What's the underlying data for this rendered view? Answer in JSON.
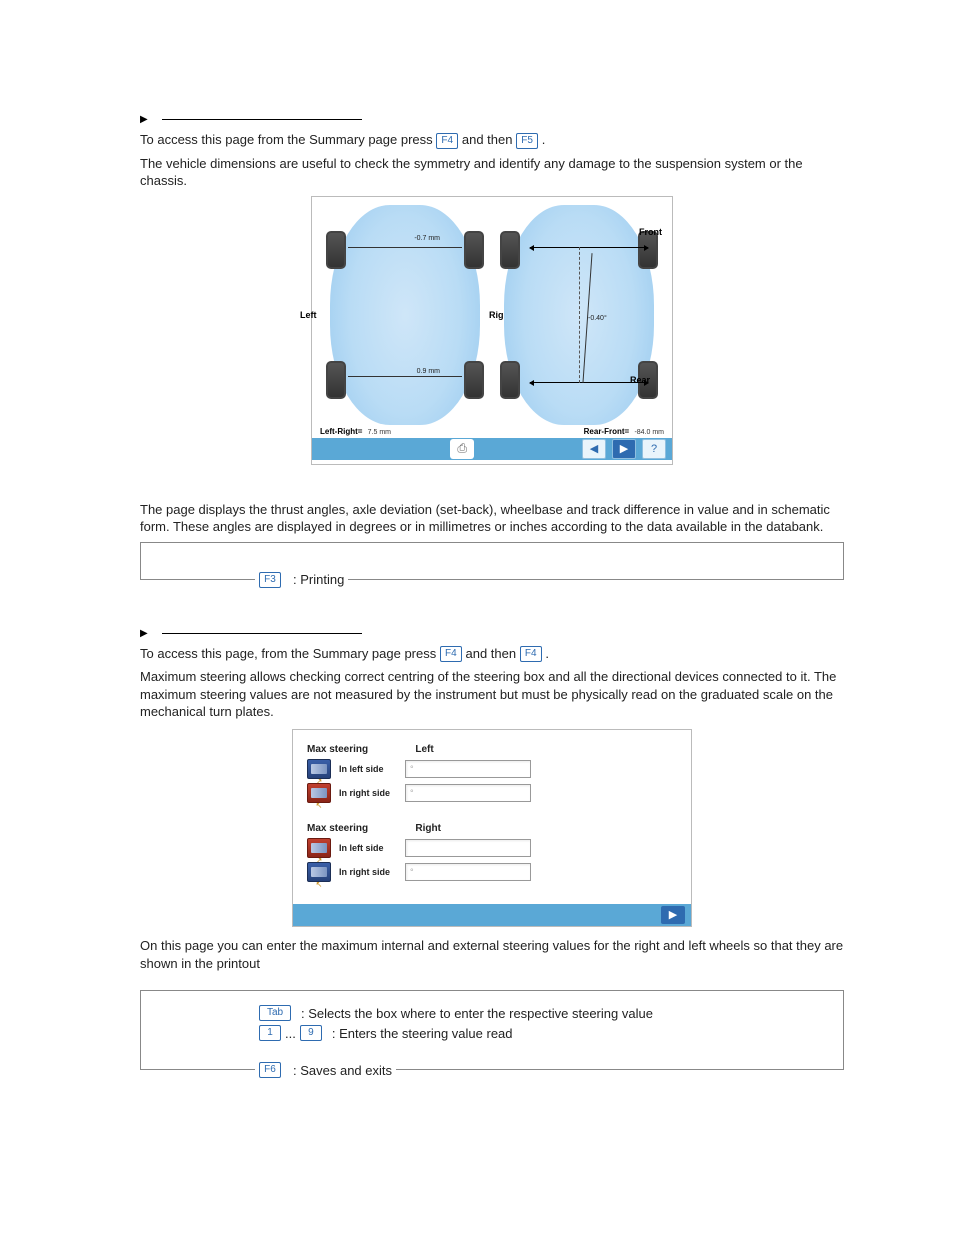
{
  "sectionA": {
    "access1": "To access this page from the Summary page press ",
    "key1": "F4",
    "access2": " and then ",
    "key2": "F5",
    "access3": ".",
    "para2": "The vehicle dimensions are useful to check the symmetry and identify any damage to the suspension system or the chassis."
  },
  "fig1": {
    "left": "Left",
    "right": "Right",
    "front": "Front",
    "rear": "Rear",
    "topval": "-0.7 mm",
    "botval": "0.9 mm",
    "thrust": "-0.40°",
    "lr_label": "Left-Right=",
    "lr_val": "7.5 mm",
    "rf_label": "Rear-Front=",
    "rf_val": "-84.0 mm"
  },
  "sectionA_para3": "The page displays the thrust angles, axle deviation (set-back), wheelbase and track difference in value and in schematic form. These angles are displayed in degrees or in millimetres or inches according to the data available in the databank.",
  "legend1": {
    "key": "F3",
    "text": ": Printing"
  },
  "sectionB": {
    "access1": "To access this page, from the Summary page press ",
    "key1": "F4",
    "access2": " and then ",
    "key2": "F4",
    "access3": ".",
    "para2": "Maximum steering allows checking correct centring of the steering box and all the directional devices connected to it. The maximum steering values are not measured by the instrument but must be physically read on the graduated scale on the mechanical turn plates."
  },
  "fig2": {
    "title": "Max steering",
    "col_left": "Left",
    "col_right": "Right",
    "in_left": "In left side",
    "in_right": "In right side",
    "placeholder": "°"
  },
  "para_after_fig2": "On this page you can enter the maximum internal and external steering values for the right and left wheels so that they are shown in the printout",
  "legend2": {
    "k_tab": "Tab",
    "t_tab": ": Selects the box where to enter the respective steering value",
    "k_1": "1",
    "dots": "...",
    "k_9": "9",
    "t_num": ": Enters the steering value read",
    "k_f6": "F6",
    "t_f6": ": Saves and exits"
  }
}
